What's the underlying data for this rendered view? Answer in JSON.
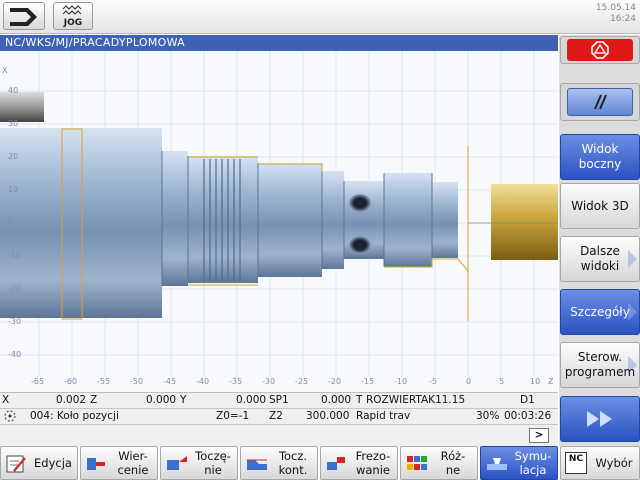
{
  "header": {
    "mode_label": "JOG",
    "date": "15.05.14",
    "time": "16:24"
  },
  "path": "NC/WKS/MJ/PRACADYPLOMOWA",
  "plot": {
    "x_ticks": [
      "-65",
      "-60",
      "-55",
      "-50",
      "-45",
      "-40",
      "-35",
      "-30",
      "-25",
      "-20",
      "-15",
      "-10",
      "-5",
      "0",
      "5",
      "10"
    ],
    "y_ticks": [
      "40",
      "30",
      "20",
      "10",
      "0",
      "-10",
      "-20",
      "-30",
      "-40"
    ],
    "axis_x_label": "Z",
    "axis_y_label": "X"
  },
  "status": {
    "row1": {
      "ax1": "X",
      "v1": "0.002",
      "ax2": "Z",
      "v2": "0.000",
      "ax3": "Y",
      "v3": "0.000",
      "sp": "SP1",
      "v4": "0.000",
      "tool_prefix": "T",
      "tool": "ROZWIERTAK11.15",
      "d": "D1"
    },
    "row2": {
      "block": "004: Koło pozycji",
      "z0": "Z0=-1",
      "z2": "Z2",
      "feed": "300.000",
      "feed_text": "Rapid trav",
      "pct": "30%",
      "elapsed": "00:03:26"
    },
    "scroll_arrow": ">"
  },
  "vertical_softkeys": {
    "k3": "Widok boczny",
    "k4": "Widok 3D",
    "k5": "Dalsze widoki",
    "k6": "Szczegóły",
    "k7": "Sterow. programem"
  },
  "horizontal_softkeys": {
    "edit": "Edycja",
    "drill_1": "Wier-",
    "drill_2": "cenie",
    "turn_1": "Toczę-",
    "turn_2": "nie",
    "contour_1": "Tocz.",
    "contour_2": "kont.",
    "mill_1": "Frezo-",
    "mill_2": "wanie",
    "misc_1": "Róż-",
    "misc_2": "ne",
    "sim_1": "Symu-",
    "sim_2": "lacja",
    "select": "Wybór",
    "nc_badge": "NC"
  }
}
